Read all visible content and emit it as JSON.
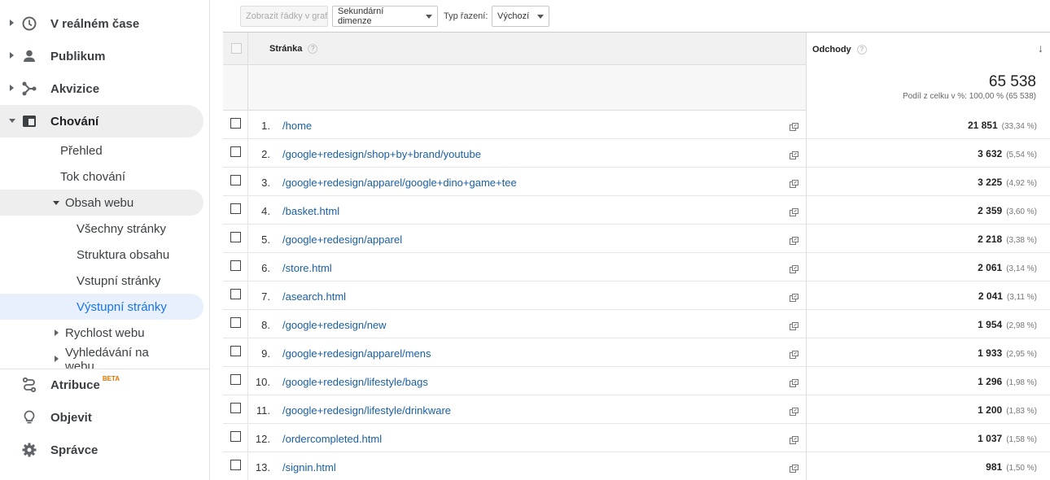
{
  "sidebar": {
    "realtime": "V reálném čase",
    "audience": "Publikum",
    "acquisition": "Akvizice",
    "behavior": "Chování",
    "behavior_sub": {
      "overview": "Přehled",
      "flow": "Tok chování",
      "site_content": "Obsah webu",
      "all_pages": "Všechny stránky",
      "content_drilldown": "Struktura obsahu",
      "landing_pages": "Vstupní stránky",
      "exit_pages": "Výstupní stránky",
      "site_speed": "Rychlost webu",
      "site_search": "Vyhledávání na webu"
    },
    "attribution": "Atribuce",
    "beta": "BETA",
    "discover": "Objevit",
    "admin": "Správce"
  },
  "toolbar": {
    "plot_rows": "Zobrazit řádky v grafu",
    "secondary_dimension": "Sekundární dimenze",
    "sort_type_label": "Typ řazení:",
    "sort_type_value": "Výchozí"
  },
  "table": {
    "col_page": "Stránka",
    "col_metric": "Odchody",
    "help": "?",
    "sort_arrow": "↓",
    "total_value": "65 538",
    "total_sub": "Podíl z celku v %: 100,00 % (65 538)",
    "rows": [
      {
        "num": "1.",
        "page": "/home",
        "value": "21 851",
        "pct": "(33,34 %)"
      },
      {
        "num": "2.",
        "page": "/google+redesign/shop+by+brand/youtube",
        "value": "3 632",
        "pct": "(5,54 %)"
      },
      {
        "num": "3.",
        "page": "/google+redesign/apparel/google+dino+game+tee",
        "value": "3 225",
        "pct": "(4,92 %)"
      },
      {
        "num": "4.",
        "page": "/basket.html",
        "value": "2 359",
        "pct": "(3,60 %)"
      },
      {
        "num": "5.",
        "page": "/google+redesign/apparel",
        "value": "2 218",
        "pct": "(3,38 %)"
      },
      {
        "num": "6.",
        "page": "/store.html",
        "value": "2 061",
        "pct": "(3,14 %)"
      },
      {
        "num": "7.",
        "page": "/asearch.html",
        "value": "2 041",
        "pct": "(3,11 %)"
      },
      {
        "num": "8.",
        "page": "/google+redesign/new",
        "value": "1 954",
        "pct": "(2,98 %)"
      },
      {
        "num": "9.",
        "page": "/google+redesign/apparel/mens",
        "value": "1 933",
        "pct": "(2,95 %)"
      },
      {
        "num": "10.",
        "page": "/google+redesign/lifestyle/bags",
        "value": "1 296",
        "pct": "(1,98 %)"
      },
      {
        "num": "11.",
        "page": "/google+redesign/lifestyle/drinkware",
        "value": "1 200",
        "pct": "(1,83 %)"
      },
      {
        "num": "12.",
        "page": "/ordercompleted.html",
        "value": "1 037",
        "pct": "(1,58 %)"
      },
      {
        "num": "13.",
        "page": "/signin.html",
        "value": "981",
        "pct": "(1,50 %)"
      }
    ]
  }
}
